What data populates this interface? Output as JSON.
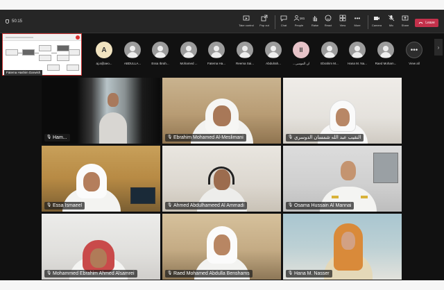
{
  "meeting": {
    "timer": "50:15"
  },
  "toolbar": {
    "buttons": [
      {
        "label": "Take control",
        "icon": "take-control-icon"
      },
      {
        "label": "Pop out",
        "icon": "pop-out-icon"
      },
      {
        "label": "Chat",
        "icon": "chat-icon"
      },
      {
        "label": "People",
        "icon": "people-icon",
        "badge": "161"
      },
      {
        "label": "Raise",
        "icon": "raise-hand-icon"
      },
      {
        "label": "React",
        "icon": "react-icon"
      },
      {
        "label": "View",
        "icon": "view-icon"
      },
      {
        "label": "More",
        "icon": "more-icon"
      },
      {
        "label": "Camera",
        "icon": "camera-icon"
      },
      {
        "label": "Mic",
        "icon": "mic-icon"
      },
      {
        "label": "Share",
        "icon": "share-icon"
      }
    ],
    "leave_label": "Leave"
  },
  "shared_screen": {
    "presenter": "Fatema Hashim Darwish"
  },
  "participants": [
    {
      "initial": "A",
      "name": "aj.a@aeo..."
    },
    {
      "name": "ABDULLA..."
    },
    {
      "name": "Essa Ibrah..."
    },
    {
      "name": "Mohamed ..."
    },
    {
      "name": "Fatema Ha..."
    },
    {
      "name": "Reema Sai..."
    },
    {
      "name": "Abdulrah..."
    },
    {
      "initial": "II",
      "name": "...ان الموسى"
    },
    {
      "name": "Ebrahim M..."
    },
    {
      "name": "Hana M. Na..."
    },
    {
      "name": "Raed Moham..."
    },
    {
      "name": "View all"
    }
  ],
  "tiles": [
    {
      "name": "Ham..."
    },
    {
      "name": "Ebrahim Mohamed Al-Meslimani"
    },
    {
      "name": "النقيب عبد الله شمسان الدوسري"
    },
    {
      "name": "Essa Ismaeel"
    },
    {
      "name": "Ahmed Abdulhameed Al Ammadi"
    },
    {
      "name": "Osama Hussain Al Mannai"
    },
    {
      "name": "Mohammed Ebrahim Ahmed Alsamrei"
    },
    {
      "name": "Raed Mohamed Abdulla Benshams"
    },
    {
      "name": "Hana M. Nasser"
    }
  ],
  "colors": {
    "leave": "#c4314b",
    "toolbar": "#262626",
    "background": "#111111"
  }
}
